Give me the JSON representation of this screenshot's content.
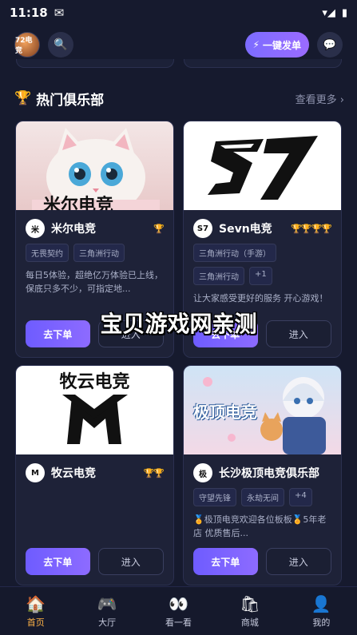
{
  "status_bar": {
    "time": "11:18",
    "mail_icon": "✉",
    "signal": "▾◢",
    "battery": "▮"
  },
  "header": {
    "avatar_text": "72电竞",
    "search_icon": "🔍",
    "quick_order_icon": "⚡",
    "quick_order_label": "一键发单",
    "message_icon": "💬"
  },
  "section": {
    "icon": "🏆",
    "title": "热门俱乐部",
    "more_label": "查看更多 ›"
  },
  "clubs": [
    {
      "name": "米尔电竞",
      "logo_text": "米",
      "trophies": "🏆",
      "tags": [
        "无畏契约",
        "三角洲行动"
      ],
      "description": "每日5体验，超绝亿万体验已上线，保底只多不少，可指定地...",
      "order_label": "去下单",
      "enter_label": "进入",
      "banner_text": "米尔电竞"
    },
    {
      "name": "Sevn电竞",
      "logo_text": "S7",
      "trophies": "🏆🏆🏆🏆",
      "tags": [
        "三角洲行动（手游）",
        "三角洲行动",
        "+1"
      ],
      "description": "让大家感受更好的服务 开心游戏！",
      "order_label": "去下单",
      "enter_label": "进入",
      "banner_text": "57"
    },
    {
      "name": "牧云电竞",
      "logo_text": "M",
      "trophies": "🏆🏆",
      "tags": [],
      "description": "",
      "order_label": "去下单",
      "enter_label": "进入",
      "banner_text": "牧云电竞"
    },
    {
      "name": "长沙极顶电竞俱乐部",
      "logo_text": "极",
      "trophies": "",
      "tags": [
        "守望先锋",
        "永劫无间",
        "+4"
      ],
      "description": "🏅极顶电竞欢迎各位板板🏅5年老店 优质售后...",
      "order_label": "去下单",
      "enter_label": "进入",
      "banner_text": "极顶电竞"
    }
  ],
  "watermark": "宝贝游戏网亲测",
  "bottom_nav": [
    {
      "icon": "🏠",
      "label": "首页",
      "active": true
    },
    {
      "icon": "🎮",
      "label": "大厅",
      "active": false
    },
    {
      "icon": "👀",
      "label": "看一看",
      "active": false
    },
    {
      "icon": "🛍",
      "label": "商城",
      "active": false
    },
    {
      "icon": "👤",
      "label": "我的",
      "active": false
    }
  ]
}
